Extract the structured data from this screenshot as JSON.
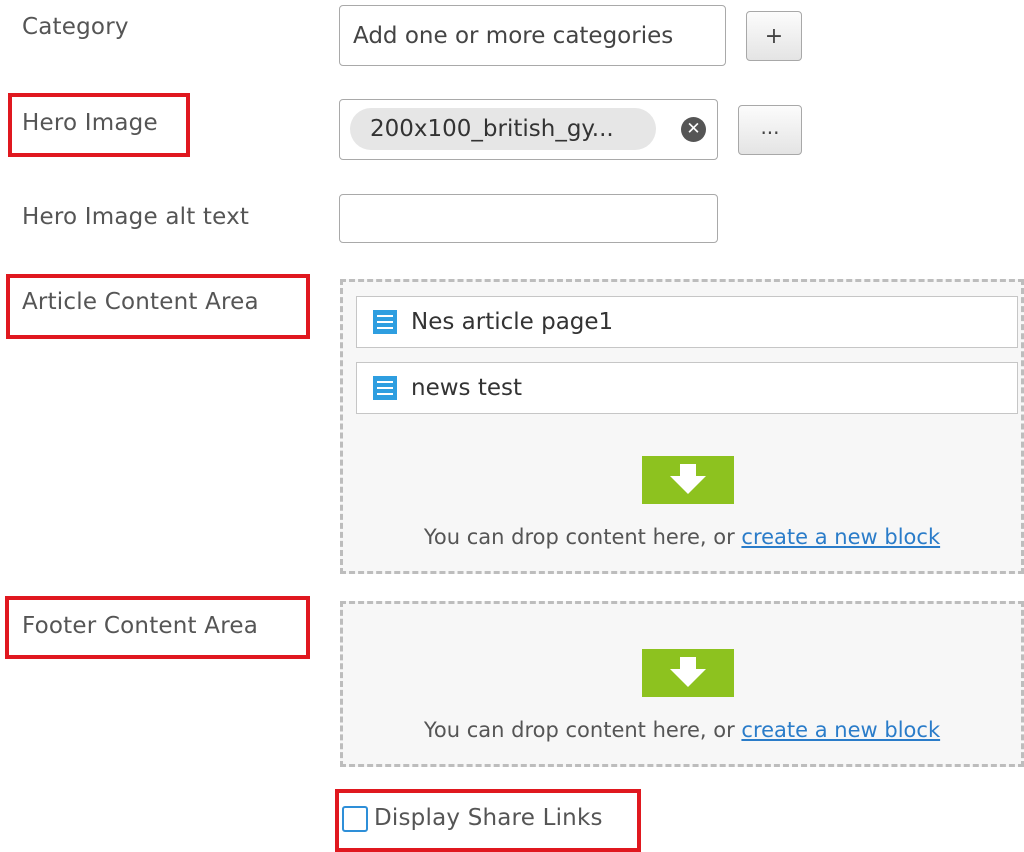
{
  "fields": {
    "category": {
      "label": "Category",
      "placeholder": "Add one or more categories",
      "add_button": "+"
    },
    "hero_image": {
      "label": "Hero Image",
      "file_name": "200x100_british_gy...",
      "clear_icon": "x-circle-icon",
      "browse_button": "..."
    },
    "hero_image_alt": {
      "label": "Hero Image alt text",
      "value": ""
    },
    "article_content_area": {
      "label": "Article Content Area",
      "items": [
        {
          "title": "Nes article page1",
          "icon": "block-list-icon"
        },
        {
          "title": "news test",
          "icon": "block-list-icon"
        }
      ],
      "drop_text": "You can drop content here, or",
      "create_link": "create a new block"
    },
    "footer_content_area": {
      "label": "Footer Content Area",
      "drop_text": "You can drop content here, or",
      "create_link": "create a new block"
    },
    "display_share_links": {
      "label": "Display Share Links",
      "checked": false
    }
  },
  "colors": {
    "highlight": "#e0181f",
    "drop_arrow": "#8dc21f",
    "block_icon": "#2e9ee0",
    "link": "#2a7cc9"
  }
}
